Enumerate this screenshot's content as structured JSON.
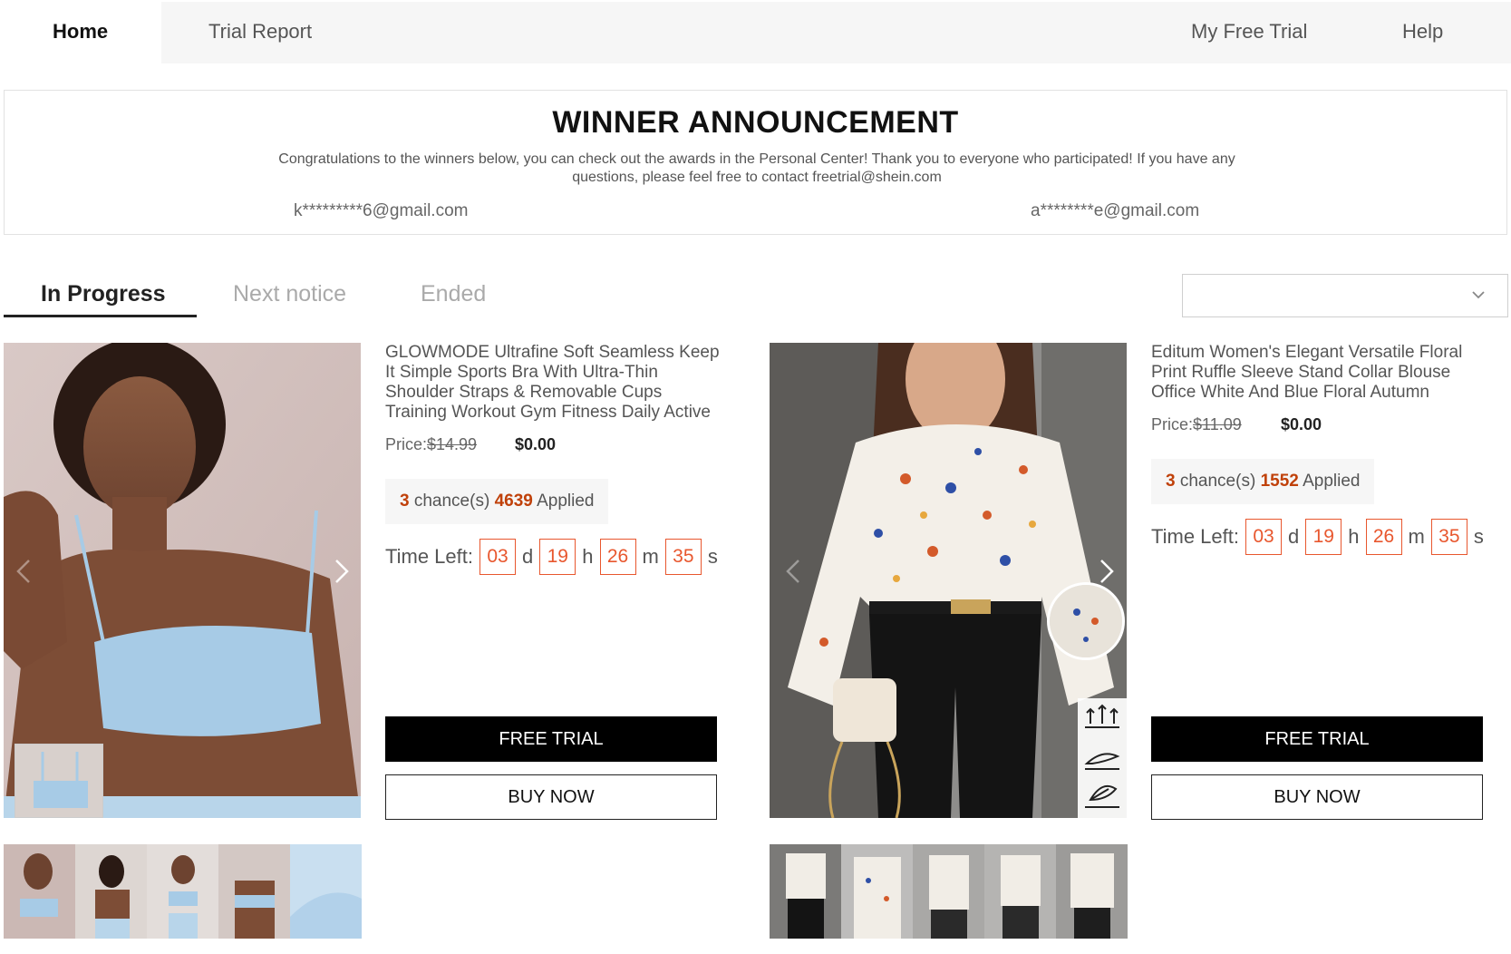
{
  "nav": {
    "home": "Home",
    "trial_report": "Trial Report",
    "my_free_trial": "My Free Trial",
    "help": "Help"
  },
  "announcement": {
    "title": "WINNER ANNOUNCEMENT",
    "text": "Congratulations to the winners below, you can check out the awards in the Personal Center! Thank you to everyone who participated! If you have any questions, please feel free to contact freetrial@shein.com",
    "winners": [
      "k*********6@gmail.com",
      "a********e@gmail.com"
    ]
  },
  "tabs": {
    "in_progress": "In Progress",
    "next_notice": "Next notice",
    "ended": "Ended"
  },
  "filter": {
    "value": ""
  },
  "products": [
    {
      "title": "GLOWMODE Ultrafine Soft Seamless Keep It Simple Sports Bra With Ultra-Thin Shoulder Straps & Removable Cups Training Workout Gym Fitness Daily Active",
      "price_label": "Price:",
      "original_price": "$14.99",
      "price": "$0.00",
      "chances": "3",
      "chances_label": "chance(s)",
      "applied": "4639",
      "applied_label": "Applied",
      "time_left_label": "Time Left:",
      "time": {
        "d": "03",
        "h": "19",
        "m": "26",
        "s": "35"
      },
      "units": {
        "d": "d",
        "h": "h",
        "m": "m",
        "s": "s"
      },
      "free_trial": "FREE TRIAL",
      "buy_now": "BUY NOW"
    },
    {
      "title": "Editum Women's Elegant Versatile Floral Print Ruffle Sleeve Stand Collar Blouse Office White And Blue Floral Autumn",
      "price_label": "Price:",
      "original_price": "$11.09",
      "price": "$0.00",
      "chances": "3",
      "chances_label": "chance(s)",
      "applied": "1552",
      "applied_label": "Applied",
      "time_left_label": "Time Left:",
      "time": {
        "d": "03",
        "h": "19",
        "m": "26",
        "s": "35"
      },
      "units": {
        "d": "d",
        "h": "h",
        "m": "m",
        "s": "s"
      },
      "free_trial": "FREE TRIAL",
      "buy_now": "BUY NOW"
    }
  ],
  "colors": {
    "accent_orange": "#e8572e",
    "applied_number": "#c0410a",
    "nav_bg": "#f6f6f6",
    "button_black": "#000000"
  }
}
